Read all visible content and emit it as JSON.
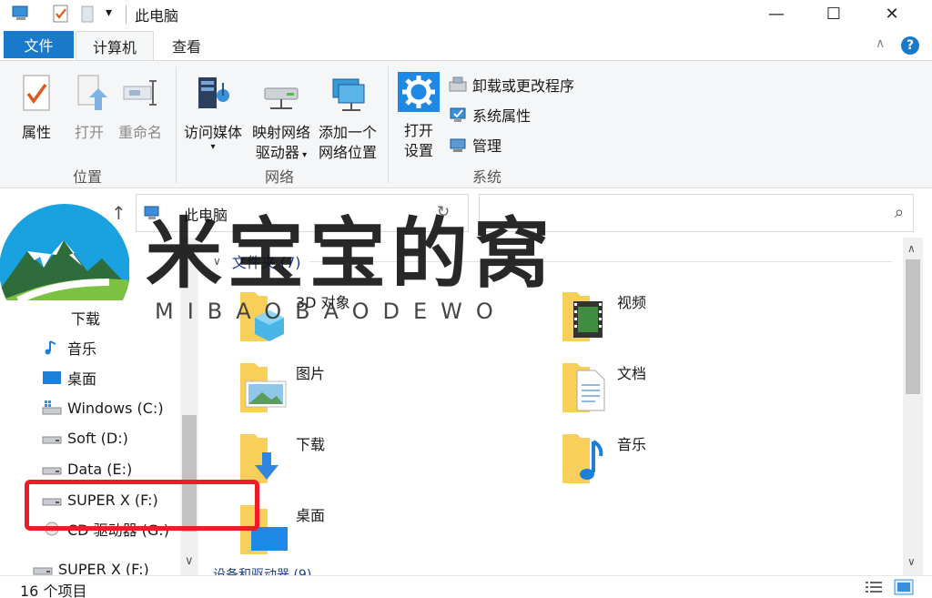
{
  "titlebar": {
    "title": "此电脑",
    "qat_dropdown": "▾",
    "minimize": "—",
    "maximize": "☐",
    "close": "✕"
  },
  "tabs": {
    "file": "文件",
    "computer": "计算机",
    "view": "查看"
  },
  "ribbon": {
    "location": {
      "label": "位置",
      "properties": "属性",
      "open": "打开",
      "rename": "重命名"
    },
    "network": {
      "label": "网络",
      "access_media": "访问媒体",
      "map_drive_1": "映射网络",
      "map_drive_2": "驱动器",
      "add_location_1": "添加一个",
      "add_location_2": "网络位置"
    },
    "system": {
      "label": "系统",
      "open_settings_1": "打开",
      "open_settings_2": "设置",
      "uninstall": "卸载或更改程序",
      "system_properties": "系统属性",
      "manage": "管理"
    }
  },
  "address": {
    "path": "此电脑",
    "search_placeholder": ""
  },
  "nav": {
    "items": [
      {
        "label": "下载",
        "icon": "download-icon"
      },
      {
        "label": "音乐",
        "icon": "music-icon"
      },
      {
        "label": "桌面",
        "icon": "desktop-icon"
      },
      {
        "label": "Windows (C:)",
        "icon": "drive-icon"
      },
      {
        "label": "Soft (D:)",
        "icon": "drive-icon"
      },
      {
        "label": "Data (E:)",
        "icon": "drive-icon"
      },
      {
        "label": "SUPER X (F:)",
        "icon": "drive-icon"
      },
      {
        "label": "CD 驱动器 (G:)",
        "icon": "cd-drive-icon"
      },
      {
        "label": "SUPER X (F:)",
        "icon": "drive-icon"
      }
    ]
  },
  "content": {
    "folders_header": "文件夹 (7)",
    "folders": [
      {
        "label": "3D 对象",
        "icon": "3d-objects-folder-icon"
      },
      {
        "label": "视频",
        "icon": "videos-folder-icon"
      },
      {
        "label": "图片",
        "icon": "pictures-folder-icon"
      },
      {
        "label": "文档",
        "icon": "documents-folder-icon"
      },
      {
        "label": "下载",
        "icon": "downloads-folder-icon"
      },
      {
        "label": "音乐",
        "icon": "music-folder-icon"
      },
      {
        "label": "桌面",
        "icon": "desktop-folder-icon"
      }
    ],
    "devices_header": "设备和驱动器 (9)"
  },
  "status": {
    "item_count": "16 个项目"
  },
  "watermark": {
    "title": "米宝宝的窝",
    "subtitle": "MIBAOBAODEWO"
  },
  "colors": {
    "accent": "#1979ca",
    "highlight": "#ee1c24",
    "folder": "#f8cf5a"
  }
}
